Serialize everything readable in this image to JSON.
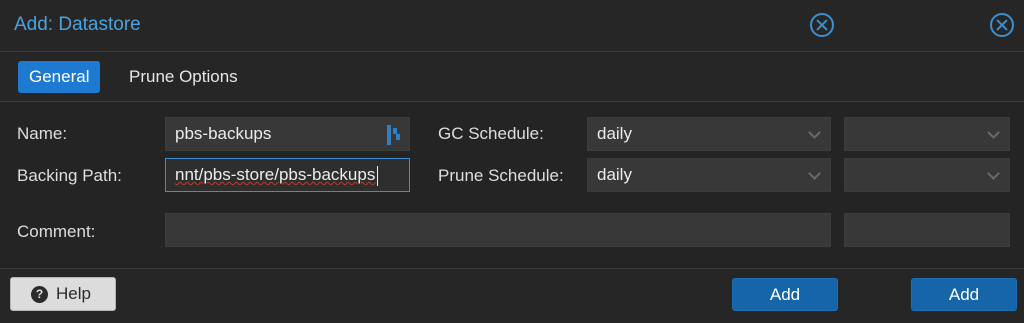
{
  "window": {
    "title": "Add: Datastore"
  },
  "tabs": [
    {
      "label": "General"
    },
    {
      "label": "Prune Options"
    }
  ],
  "form": {
    "name_label": "Name:",
    "name_value": "pbs-backups",
    "backing_path_label": "Backing Path:",
    "backing_path_value": "nnt/pbs-store/pbs-backups",
    "comment_label": "Comment:",
    "comment_value": "",
    "gc_schedule_label": "GC Schedule:",
    "gc_schedule_value": "daily",
    "prune_schedule_label": "Prune Schedule:",
    "prune_schedule_value": "daily",
    "gc_schedule_extra_value": "",
    "prune_schedule_extra_value": "",
    "comment_extra_value": ""
  },
  "footer": {
    "help_label": "Help",
    "help_icon": "?",
    "add_label": "Add",
    "add_label_2": "Add"
  },
  "icons": {
    "close": "close-circle-icon",
    "password_manager": "password-manager-icon",
    "dropdown": "chevron-down-icon",
    "help": "question-circle-icon"
  },
  "colors": {
    "accent": "#1e7ad0",
    "title": "#4aa3df",
    "button": "#1565a8"
  }
}
